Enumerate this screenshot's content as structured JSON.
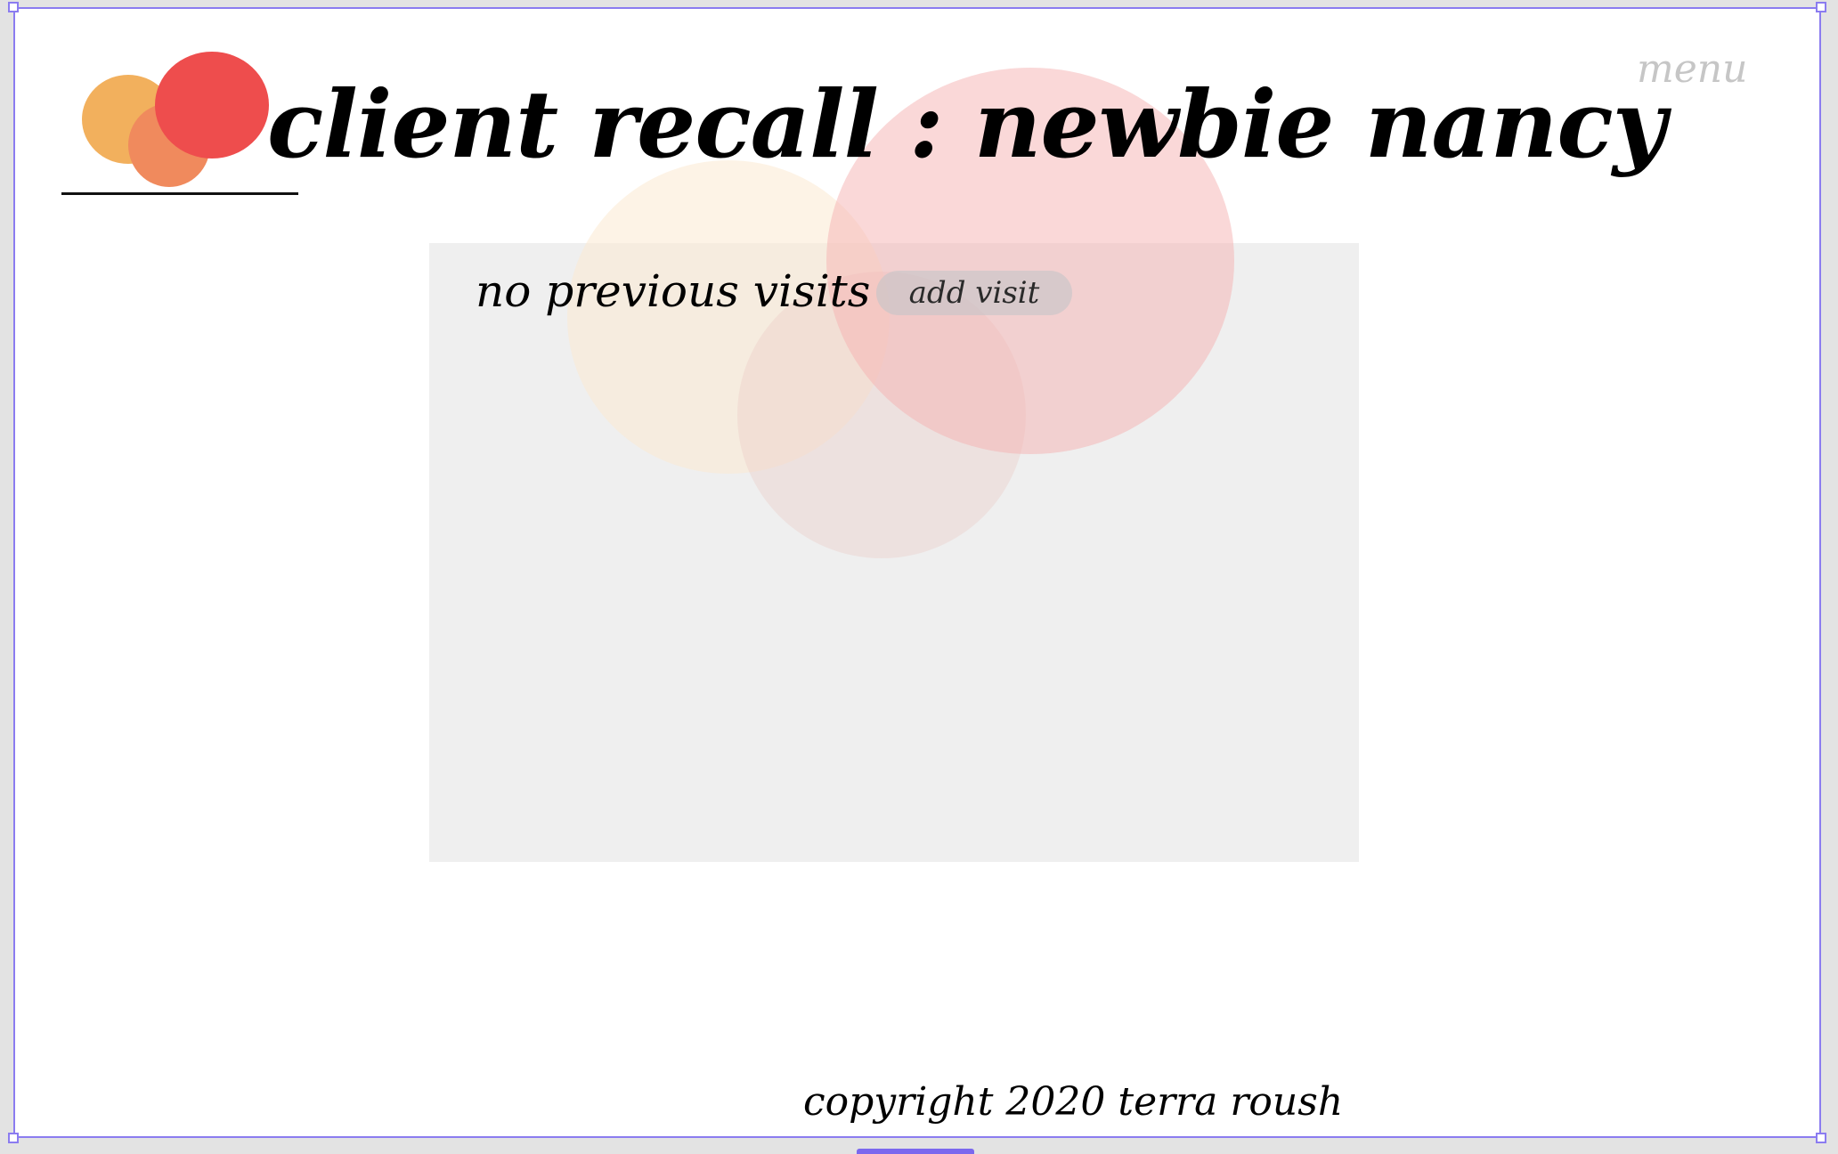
{
  "header": {
    "title": "client recall : newbie nancy",
    "menu_label": "menu"
  },
  "visits": {
    "empty_message": "no previous visits",
    "add_visit_label": "add visit"
  },
  "footer": {
    "copyright": "copyright 2020 terra roush"
  },
  "colors": {
    "logo_orange": "#f2b05d",
    "logo_coral": "#f08a5d",
    "logo_red": "#ee4d4d",
    "panel_background": "#efefef",
    "selection_frame": "#8b7cf0"
  }
}
